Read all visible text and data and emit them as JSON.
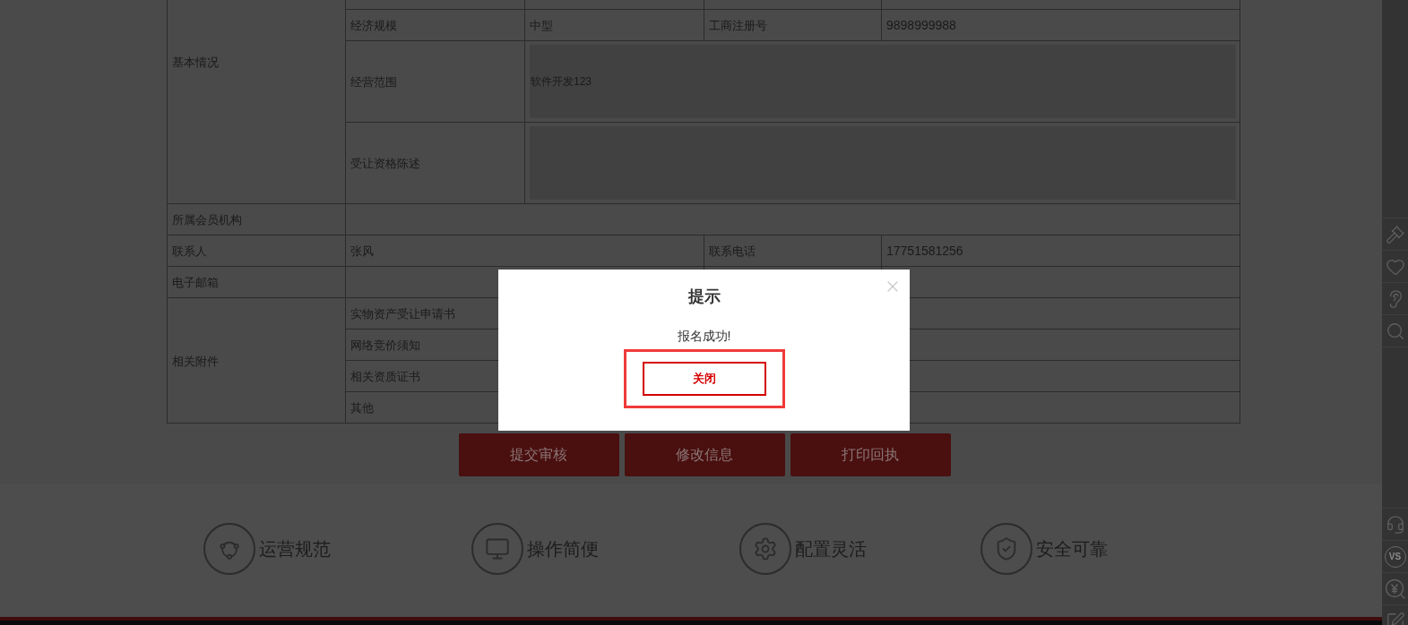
{
  "table": {
    "basic_info": {
      "label": "基本情况",
      "economic_scale": {
        "label": "经济规模",
        "value": "中型"
      },
      "registration_number": {
        "label": "工商注册号",
        "value": "9898999988"
      },
      "business_scope": {
        "label": "经营范围",
        "value": "软件开发123"
      },
      "qualification_statement": {
        "label": "受让资格陈述"
      }
    },
    "member_org": {
      "label": "所属会员机构"
    },
    "contact_person": {
      "label": "联系人",
      "value": "张风"
    },
    "contact_phone": {
      "label": "联系电话",
      "value": "17751581256"
    },
    "email": {
      "label": "电子邮箱"
    },
    "attachments": {
      "label": "相关附件",
      "items": [
        "实物资产受让申请书",
        "网络竞价须知",
        "相关资质证书",
        "其他"
      ]
    }
  },
  "action_buttons": [
    "提交审核",
    "修改信息",
    "打印回执"
  ],
  "features": [
    {
      "kind": "cycle",
      "label": "运营规范"
    },
    {
      "kind": "monitor",
      "label": "操作简便"
    },
    {
      "kind": "gear",
      "label": "配置灵活"
    },
    {
      "kind": "shield",
      "label": "安全可靠"
    }
  ],
  "sidebar": {
    "top_tools": [
      {
        "kind": "gavel"
      },
      {
        "kind": "heart"
      },
      {
        "kind": "ear"
      },
      {
        "kind": "search"
      }
    ],
    "bottom_tools": [
      {
        "kind": "headset"
      },
      {
        "kind": "versus",
        "text": "VS"
      },
      {
        "kind": "yen"
      },
      {
        "kind": "edit"
      }
    ]
  },
  "dialog": {
    "title": "提示",
    "message": "报名成功!",
    "button": "关闭",
    "highlighted": true
  }
}
